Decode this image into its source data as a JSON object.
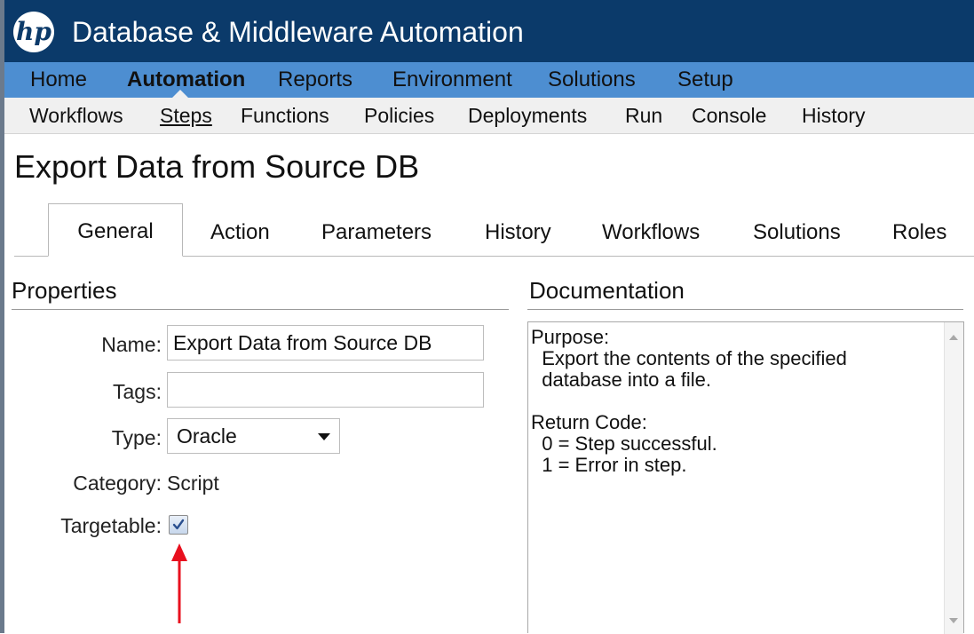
{
  "app": {
    "title": "Database & Middleware Automation",
    "logo_text": "hp"
  },
  "main_nav": {
    "items": [
      {
        "label": "Home"
      },
      {
        "label": "Automation",
        "active": true
      },
      {
        "label": "Reports"
      },
      {
        "label": "Environment"
      },
      {
        "label": "Solutions"
      },
      {
        "label": "Setup"
      }
    ]
  },
  "sub_nav": {
    "items": [
      {
        "label": "Workflows"
      },
      {
        "label": "Steps",
        "active": true
      },
      {
        "label": "Functions"
      },
      {
        "label": "Policies"
      },
      {
        "label": "Deployments"
      },
      {
        "label": "Run"
      },
      {
        "label": "Console"
      },
      {
        "label": "History"
      }
    ]
  },
  "page": {
    "title": "Export Data from Source DB"
  },
  "tabs": [
    {
      "label": "General",
      "active": true
    },
    {
      "label": "Action"
    },
    {
      "label": "Parameters"
    },
    {
      "label": "History"
    },
    {
      "label": "Workflows"
    },
    {
      "label": "Solutions"
    },
    {
      "label": "Roles"
    }
  ],
  "properties": {
    "section_title": "Properties",
    "name_label": "Name:",
    "name_value": "Export Data from Source DB",
    "tags_label": "Tags:",
    "tags_value": "",
    "type_label": "Type:",
    "type_value": "Oracle",
    "category_label": "Category:",
    "category_value": "Script",
    "targetable_label": "Targetable:",
    "targetable_checked": true
  },
  "documentation": {
    "section_title": "Documentation",
    "text": "Purpose:\n  Export the contents of the specified\n  database into a file.\n\nReturn Code:\n  0 = Step successful.\n  1 = Error in step."
  },
  "colors": {
    "title_bar": "#0b3a6a",
    "main_nav": "#4d8ed1",
    "sub_nav": "#f0f0f0",
    "annotation_arrow": "#e8101e"
  },
  "icons": {
    "logo": "hp-logo-icon",
    "dropdown": "chevron-down-icon",
    "check": "checkmark-icon",
    "annotation": "red-arrow-icon"
  }
}
